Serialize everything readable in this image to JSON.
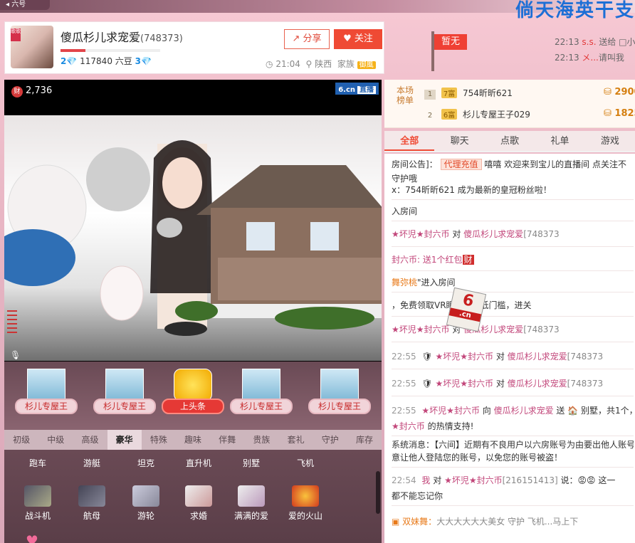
{
  "anchor": {
    "name": "傻瓜杉儿求宠爱",
    "room_id": "(748373)",
    "avatar_tag": "歌歌",
    "level_left": "2",
    "beans": "117840 六豆",
    "level_right": "3",
    "time": "21:04",
    "location": "陕西",
    "family_label": "家族",
    "family_badge": "御風",
    "share_label": "分享",
    "follow_label": "关注"
  },
  "banner": {
    "big_text": "倘天海英干支"
  },
  "flag_label": "暂无",
  "feed": [
    {
      "time": "22:13",
      "user": "s.s.",
      "text": " 送给 □小"
    },
    {
      "time": "22:13",
      "user": "メ...",
      "text": "请叫我"
    }
  ],
  "video": {
    "coin_icon": "财",
    "coin_count": "2,736",
    "logo": "6.cn",
    "live": "直播",
    "mic_icon": "microphone-icon"
  },
  "gifts_shelf": [
    {
      "label": "杉儿专屋王"
    },
    {
      "label": "杉儿专屋王"
    },
    {
      "label": "上头条"
    },
    {
      "label": "杉儿专屋王"
    },
    {
      "label": "杉儿专屋王"
    }
  ],
  "gift_tabs": [
    "初级",
    "中级",
    "高级",
    "豪华",
    "特殊",
    "趣味",
    "伴舞",
    "贵族",
    "套礼",
    "守护",
    "库存"
  ],
  "gift_tab_active": "豪华",
  "gift_items_row1": [
    "跑车",
    "游艇",
    "坦克",
    "直升机",
    "别墅",
    "飞机"
  ],
  "gift_items_row2": [
    "战斗机",
    "航母",
    "游轮",
    "求婚",
    "满满的爱",
    "爱的火山"
  ],
  "rank": {
    "title": "本场榜单",
    "rows": [
      {
        "n": "1",
        "lv": "7富",
        "name": "754昕昕621",
        "pts": "2900"
      },
      {
        "n": "2",
        "lv": "6富",
        "name": "杉儿专屋王子029",
        "pts": "1825"
      }
    ]
  },
  "chat_tabs": [
    "全部",
    "聊天",
    "点歌",
    "礼单",
    "游戏"
  ],
  "chat_tab_active": "全部",
  "chat": {
    "notice_label": "房间公告]：",
    "notice_badge": "代理充值",
    "notice_text": "嘻嘻 欢迎来到宝儿的直播间 点关注不",
    "notice_text2": "守护哦",
    "l1": "x：754昕昕621 成为最新的皇冠粉丝啦！",
    "l2": "入房间",
    "l3a": "★坏児★封六币",
    "l3b": " 对 ",
    "l3c": "傻瓜杉儿求宠爱",
    "l3d": "[748373",
    "l4a": "封六币: 送1个红包",
    "l4b": "财",
    "l5a": "舞弥桃",
    "l5b": "\"进入房间",
    "l6a": "，免费领取VR眼镜！超低门槛，进关",
    "l7a": "★坏児★封六币",
    "l7b": " 对 ",
    "l7c": "傻瓜杉儿求宠爱",
    "l7d": "[748373",
    "l8t": "22:55",
    "l8a": "★坏児★封六币",
    "l8b": " 对 ",
    "l8c": "傻瓜杉儿求宠爱",
    "l8d": "[748373",
    "l9t": "22:55",
    "l9a": "★坏児★封六币",
    "l9b": " 对 ",
    "l9c": "傻瓜杉儿求宠爱",
    "l9d": "[748373",
    "l10t": "22:55",
    "l10a": "★坏児★封六币",
    "l10b": " 向 ",
    "l10c": "傻瓜杉儿求宠爱",
    "l10d": " 送 ",
    "l10e": " 别墅，共1个，",
    "l10f": "★封六币",
    "l10g": " 的热情支持!",
    "sys1": "系统消息：【六间】近期有不良用户以六房账号为由要出他人账号",
    "sys2": "意让他人登陆您的账号，以免您的账号被盗！",
    "l11t": "22:54",
    "l11a": "我",
    "l11b": " 对 ",
    "l11c": "★坏児★封六币",
    "l11d": "[216151413]",
    "l11e": " 说：",
    "l11f": "这一",
    "l11g": "都不能忘记你",
    "l12a": "双妹舞：",
    "l12b": "大大大大大大美女 守护 飞机...马上下",
    "ad_big": "6",
    "ad_cn": ".cn"
  }
}
